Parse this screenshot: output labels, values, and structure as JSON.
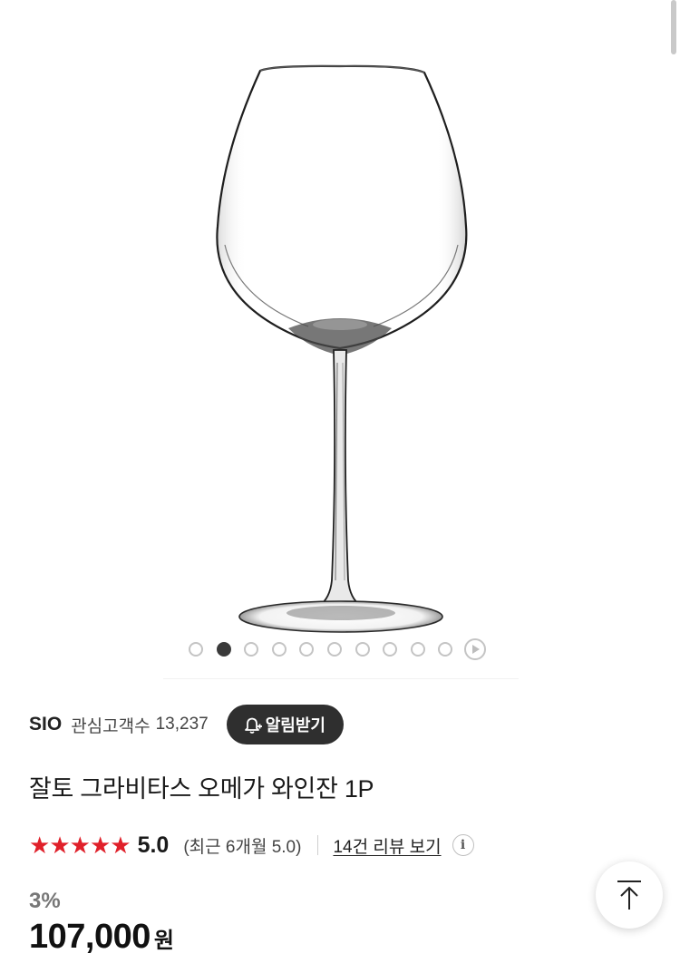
{
  "gallery": {
    "total_slides": 10,
    "active_index": 1,
    "image_name": "wine-glass"
  },
  "brand": {
    "name": "SIO",
    "followers_label": "관심고객수",
    "followers_count": "13,237",
    "alarm_button_label": "알림받기"
  },
  "product": {
    "title": "잘토 그라비타스 오메가 와인잔 1P"
  },
  "rating": {
    "stars": 5,
    "score": "5.0",
    "recent": "(최근 6개월 5.0)",
    "review_link": "14건 리뷰 보기",
    "info_icon": "i"
  },
  "price": {
    "discount": "3%",
    "amount": "107,000",
    "currency": "원"
  },
  "colors": {
    "star": "#e0202a",
    "dark_button": "#2f2f2f"
  }
}
